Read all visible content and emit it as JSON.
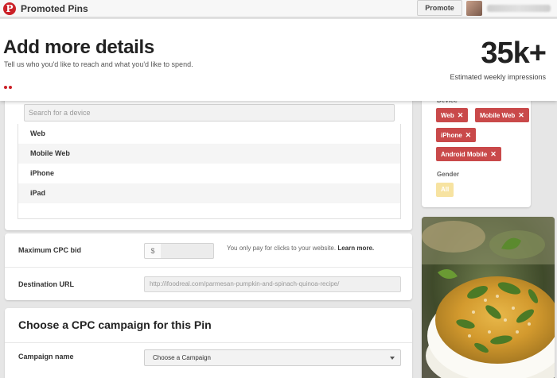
{
  "topbar": {
    "logo_glyph": "P",
    "app_title": "Promoted Pins",
    "promote_label": "Promote"
  },
  "header": {
    "title": "Add more details",
    "subtitle": "Tell us who you'd like to reach and what you'd like to spend.",
    "impressions_value": "35k+",
    "impressions_label": "Estimated weekly impressions"
  },
  "devices": {
    "search_placeholder": "Search for a device",
    "options": [
      "Web",
      "Mobile Web",
      "iPhone",
      "iPad"
    ]
  },
  "form": {
    "cpc_label": "Maximum CPC bid",
    "currency_symbol": "$",
    "cpc_note": "You only pay for clicks to your website.",
    "learn_more": "Learn more.",
    "url_label": "Destination URL",
    "url_value": "http://ifoodreal.com/parmesan-pumpkin-and-spinach-quinoa-recipe/"
  },
  "campaign": {
    "title": "Choose a CPC campaign for this Pin",
    "name_label": "Campaign name",
    "select_value": "Choose a Campaign"
  },
  "targets": {
    "device_label": "Device",
    "device_tags": [
      "Web",
      "Mobile Web",
      "iPhone",
      "Android Mobile"
    ],
    "remove_glyph": "✕",
    "gender_label": "Gender",
    "gender_value": "All"
  },
  "colors": {
    "brand_red": "#cb2027",
    "tag_red": "#c9494a",
    "gender_tag": "#f7e3a1"
  }
}
